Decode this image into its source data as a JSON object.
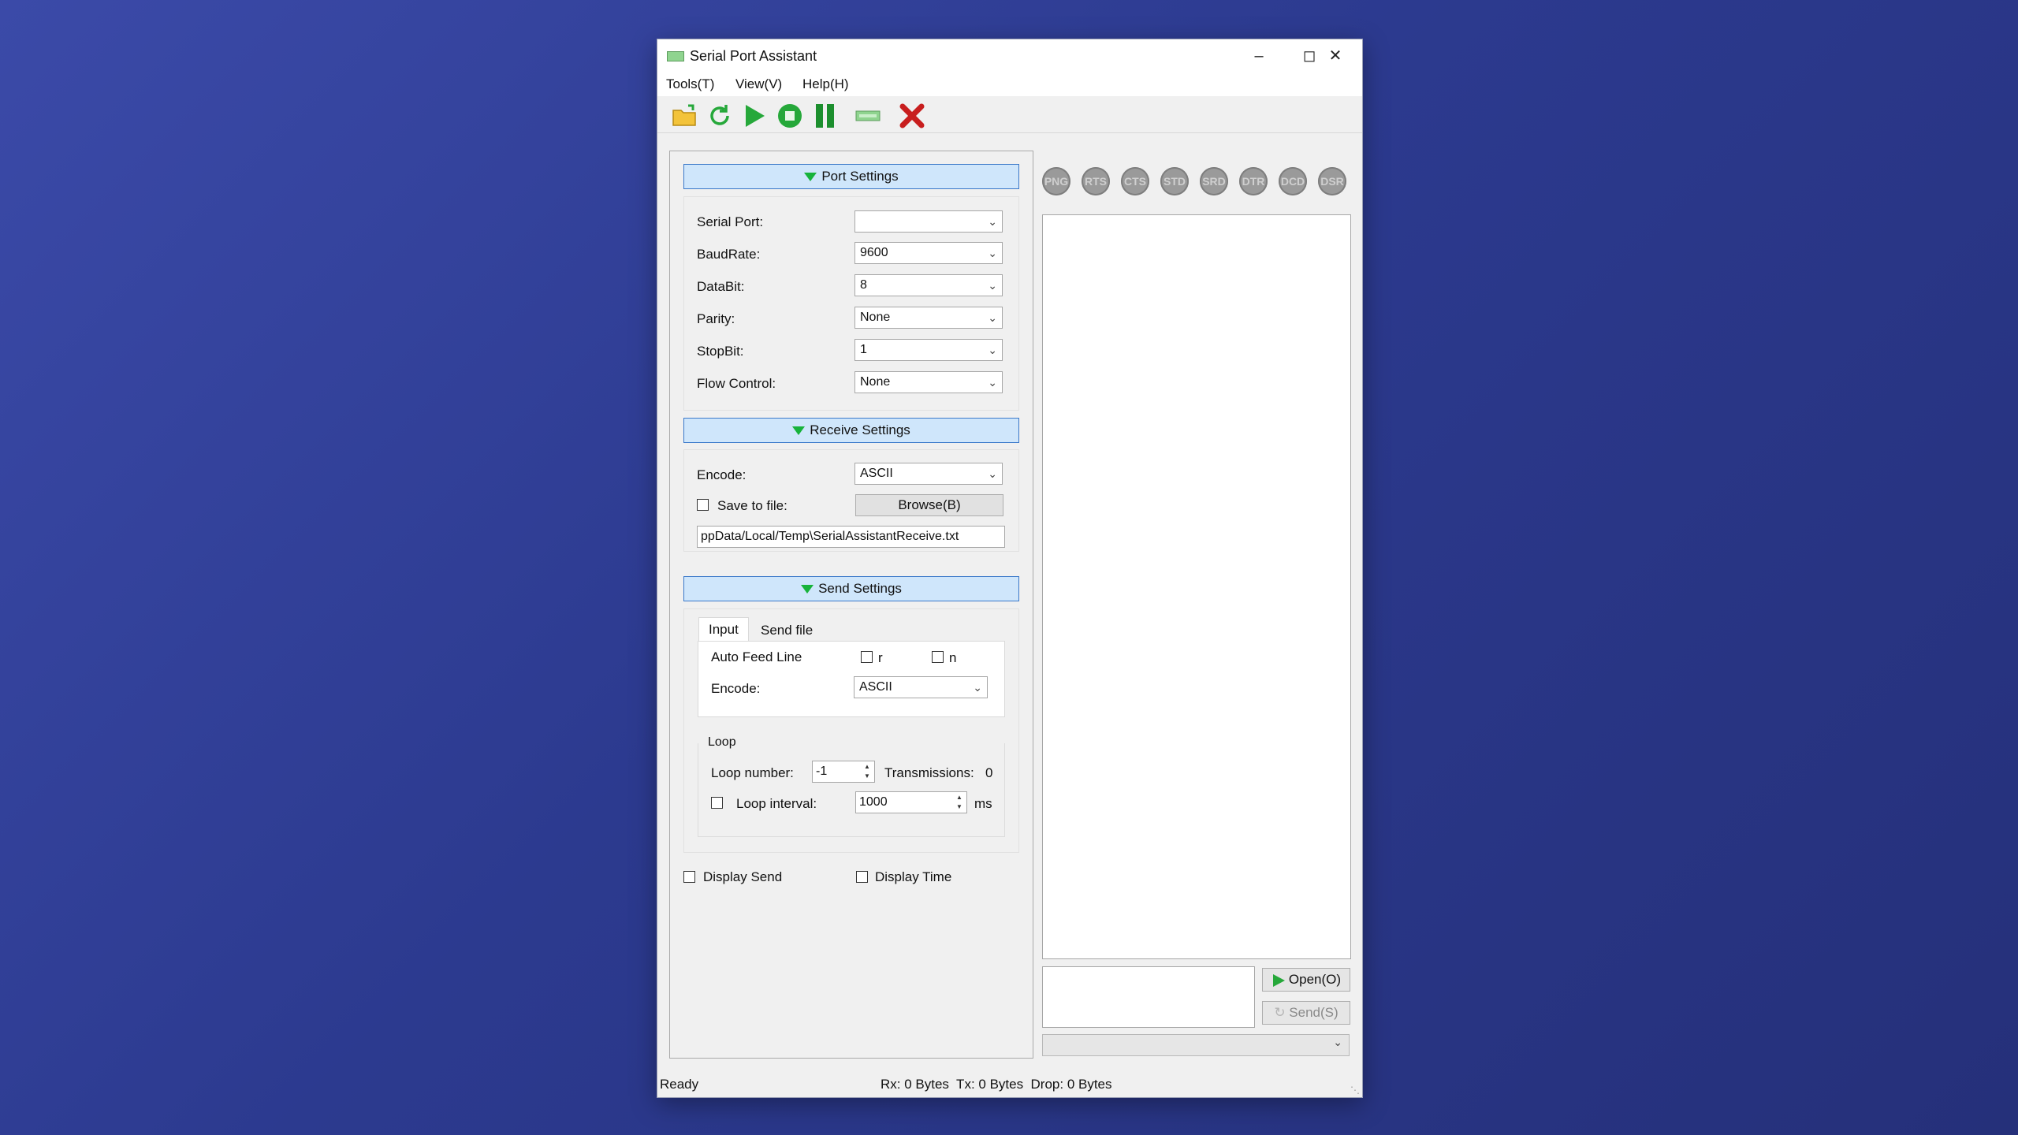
{
  "window": {
    "title": "Serial Port Assistant"
  },
  "menu": [
    "Tools(T)",
    "View(V)",
    "Help(H)"
  ],
  "toolbar": {
    "icons": [
      "open-folder-icon",
      "refresh-icon",
      "play-icon",
      "stop-icon",
      "pause-icon",
      "device-icon",
      "close-icon"
    ],
    "colors": {
      "green": "#26a83a",
      "red": "#c81e1e",
      "yellow": "#f3c33a"
    }
  },
  "port_settings": {
    "header": "Port Settings",
    "fields": [
      {
        "label": "Serial Port:",
        "value": ""
      },
      {
        "label": "BaudRate:",
        "value": "9600"
      },
      {
        "label": "DataBit:",
        "value": "8"
      },
      {
        "label": "Parity:",
        "value": "None"
      },
      {
        "label": "StopBit:",
        "value": "1"
      },
      {
        "label": "Flow Control:",
        "value": "None"
      }
    ]
  },
  "receive_settings": {
    "header": "Receive Settings",
    "encode_label": "Encode:",
    "encode_value": "ASCII",
    "save_to_file_label": "Save to file:",
    "browse_label": "Browse(B)",
    "path": "ppData/Local/Temp\\SerialAssistantReceive.txt"
  },
  "send_settings": {
    "header": "Send Settings",
    "tabs": [
      "Input",
      "Send file"
    ],
    "auto_feed_line_label": "Auto Feed Line",
    "r_label": "r",
    "n_label": "n",
    "encode_label": "Encode:",
    "encode_value": "ASCII",
    "loop_group": "Loop",
    "loop_number_label": "Loop number:",
    "loop_number_value": "-1",
    "transmissions_label": "Transmissions:",
    "transmissions_value": "0",
    "loop_interval_label": "Loop interval:",
    "loop_interval_value": "1000",
    "ms_label": "ms"
  },
  "display": {
    "display_send_label": "Display Send",
    "display_time_label": "Display Time"
  },
  "signals": [
    "PNG",
    "RTS",
    "CTS",
    "STD",
    "SRD",
    "DTR",
    "DCD",
    "DSR"
  ],
  "buttons": {
    "open_label": "Open(O)",
    "send_label": "Send(S)"
  },
  "status": {
    "state": "Ready",
    "counters": "Rx: 0 Bytes  Tx: 0 Bytes  Drop: 0 Bytes"
  }
}
